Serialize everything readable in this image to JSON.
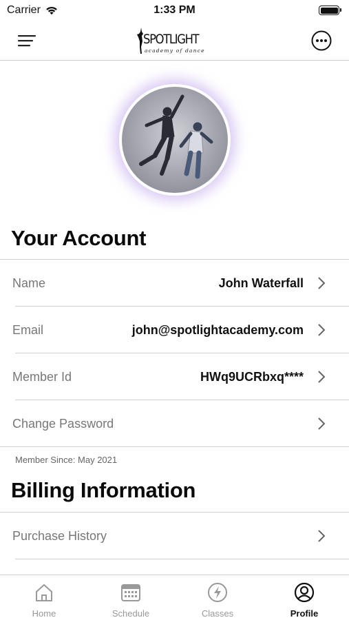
{
  "status_bar": {
    "carrier": "Carrier",
    "time": "1:33 PM"
  },
  "nav": {
    "logo_main": "SPOTLIGHT",
    "logo_sub": "academy of dance"
  },
  "account": {
    "title": "Your Account",
    "rows": [
      {
        "label": "Name",
        "value": "John Waterfall"
      },
      {
        "label": "Email",
        "value": "john@spotlightacademy.com"
      },
      {
        "label": "Member Id",
        "value": "HWq9UCRbxq****"
      },
      {
        "label": "Change Password",
        "value": ""
      }
    ],
    "member_since": "Member Since: May 2021"
  },
  "billing": {
    "title": "Billing Information",
    "rows": [
      {
        "label": "Purchase History"
      }
    ]
  },
  "tabs": [
    {
      "label": "Home",
      "icon": "home-icon"
    },
    {
      "label": "Schedule",
      "icon": "calendar-icon"
    },
    {
      "label": "Classes",
      "icon": "lightning-icon"
    },
    {
      "label": "Profile",
      "icon": "user-circle-icon",
      "active": true
    }
  ],
  "colors": {
    "avatar_glow": "#bea0eb",
    "active_tab": "#111111",
    "inactive_tab": "#999999"
  }
}
